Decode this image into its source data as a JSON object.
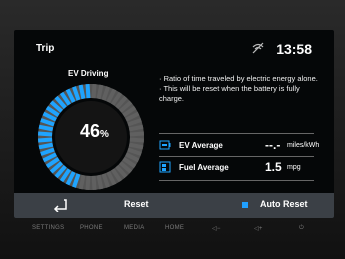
{
  "header": {
    "title": "Trip",
    "time": "13:58",
    "status_icon": "connectivity-off-icon"
  },
  "gauge": {
    "label": "EV Driving",
    "value": "46",
    "unit": "%",
    "fraction": 0.46
  },
  "info": {
    "line1": "· Ratio of time traveled by electric energy alone.",
    "line2": "· This will be reset when the battery is fully charge."
  },
  "ev_average": {
    "label": "EV Average",
    "value": "--.-",
    "unit": "miles/kWh"
  },
  "fuel_average": {
    "label": "Fuel Average",
    "value": "1.5",
    "unit": "mpg"
  },
  "bottom": {
    "reset_label": "Reset",
    "auto_reset_label": "Auto Reset"
  },
  "hardware": {
    "settings": "SETTINGS",
    "phone": "PHONE",
    "media": "MEDIA",
    "home": "HOME",
    "vol_down": "◁−",
    "vol_up": "◁+",
    "power": "⏻"
  },
  "colors": {
    "accent": "#1fa4ff",
    "bar": "#3b4046"
  }
}
